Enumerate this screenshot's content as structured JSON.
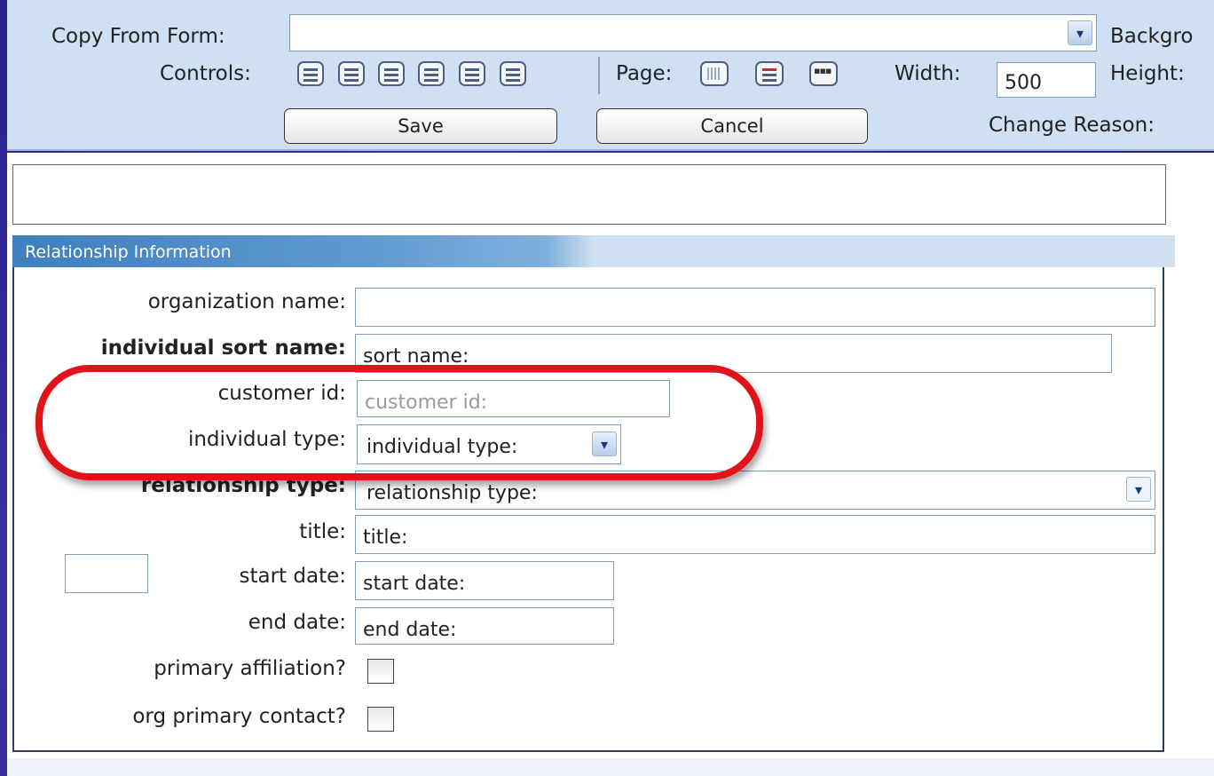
{
  "toolbar": {
    "copy_from_label": "Copy From Form:",
    "copy_from_value": "",
    "background_label": "Backgro",
    "controls_label": "Controls:",
    "page_label": "Page:",
    "width_label": "Width:",
    "width_value": "500",
    "height_label": "Height:",
    "save_label": "Save",
    "cancel_label": "Cancel",
    "change_reason_label": "Change Reason:"
  },
  "panel": {
    "title": "Relationship Information",
    "fields": [
      {
        "label": "organization name:",
        "value": "",
        "bold": false
      },
      {
        "label": "individual sort name:",
        "value": "sort name:",
        "bold": true
      },
      {
        "label": "customer id:",
        "value": "customer id:",
        "bold": false,
        "disabled": true
      },
      {
        "label": "individual type:",
        "value": "individual type:",
        "bold": false
      },
      {
        "label": "relationship type:",
        "value": "relationship type:",
        "bold": true
      },
      {
        "label": "title:",
        "value": "title:",
        "bold": false
      },
      {
        "label": "start date:",
        "value": "start date:",
        "bold": false
      },
      {
        "label": "end date:",
        "value": "end date:",
        "bold": false
      },
      {
        "label": "primary affiliation?",
        "checked": false
      },
      {
        "label": "org primary contact?",
        "checked": false
      }
    ]
  },
  "annotation_color": "#e0131a",
  "header_accent": "#3f7fbf"
}
